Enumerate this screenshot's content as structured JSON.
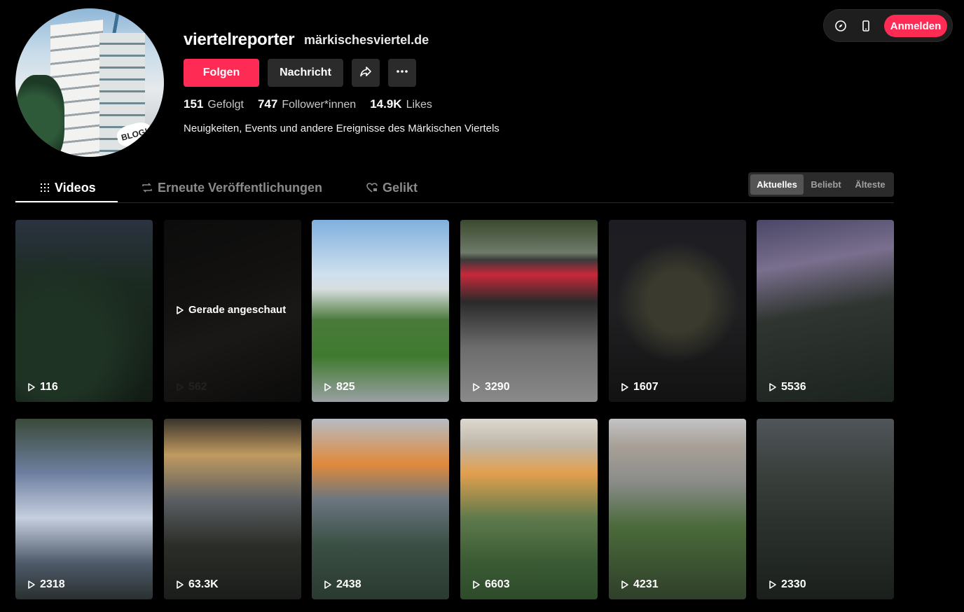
{
  "topbar": {
    "icons": [
      "compass-icon",
      "phone-icon"
    ],
    "login_label": "Anmelden",
    "accent": "#fe2c55"
  },
  "profile": {
    "username": "viertelreporter",
    "website": "märkischesviertel.de",
    "avatar_badge": "BLOG!",
    "follow_label": "Folgen",
    "message_label": "Nachricht",
    "stats": {
      "following_count": "151",
      "following_label": "Gefolgt",
      "followers_count": "747",
      "followers_label": "Follower*innen",
      "likes_count": "14.9K",
      "likes_label": "Likes"
    },
    "bio": "Neuigkeiten, Events und andere Ereignisse des Märkischen Viertels"
  },
  "tabs": {
    "videos": "Videos",
    "reposts": "Erneute Veröffentlichungen",
    "liked": "Gelikt"
  },
  "sort": {
    "latest": "Aktuelles",
    "popular": "Beliebt",
    "oldest": "Älteste"
  },
  "videos": [
    {
      "views": "116"
    },
    {
      "views": "562",
      "overlay": "Gerade angeschaut"
    },
    {
      "views": "825"
    },
    {
      "views": "3290"
    },
    {
      "views": "1607"
    },
    {
      "views": "5536"
    },
    {
      "views": "2318"
    },
    {
      "views": "63.3K"
    },
    {
      "views": "2438"
    },
    {
      "views": "6603"
    },
    {
      "views": "4231"
    },
    {
      "views": "2330"
    }
  ]
}
